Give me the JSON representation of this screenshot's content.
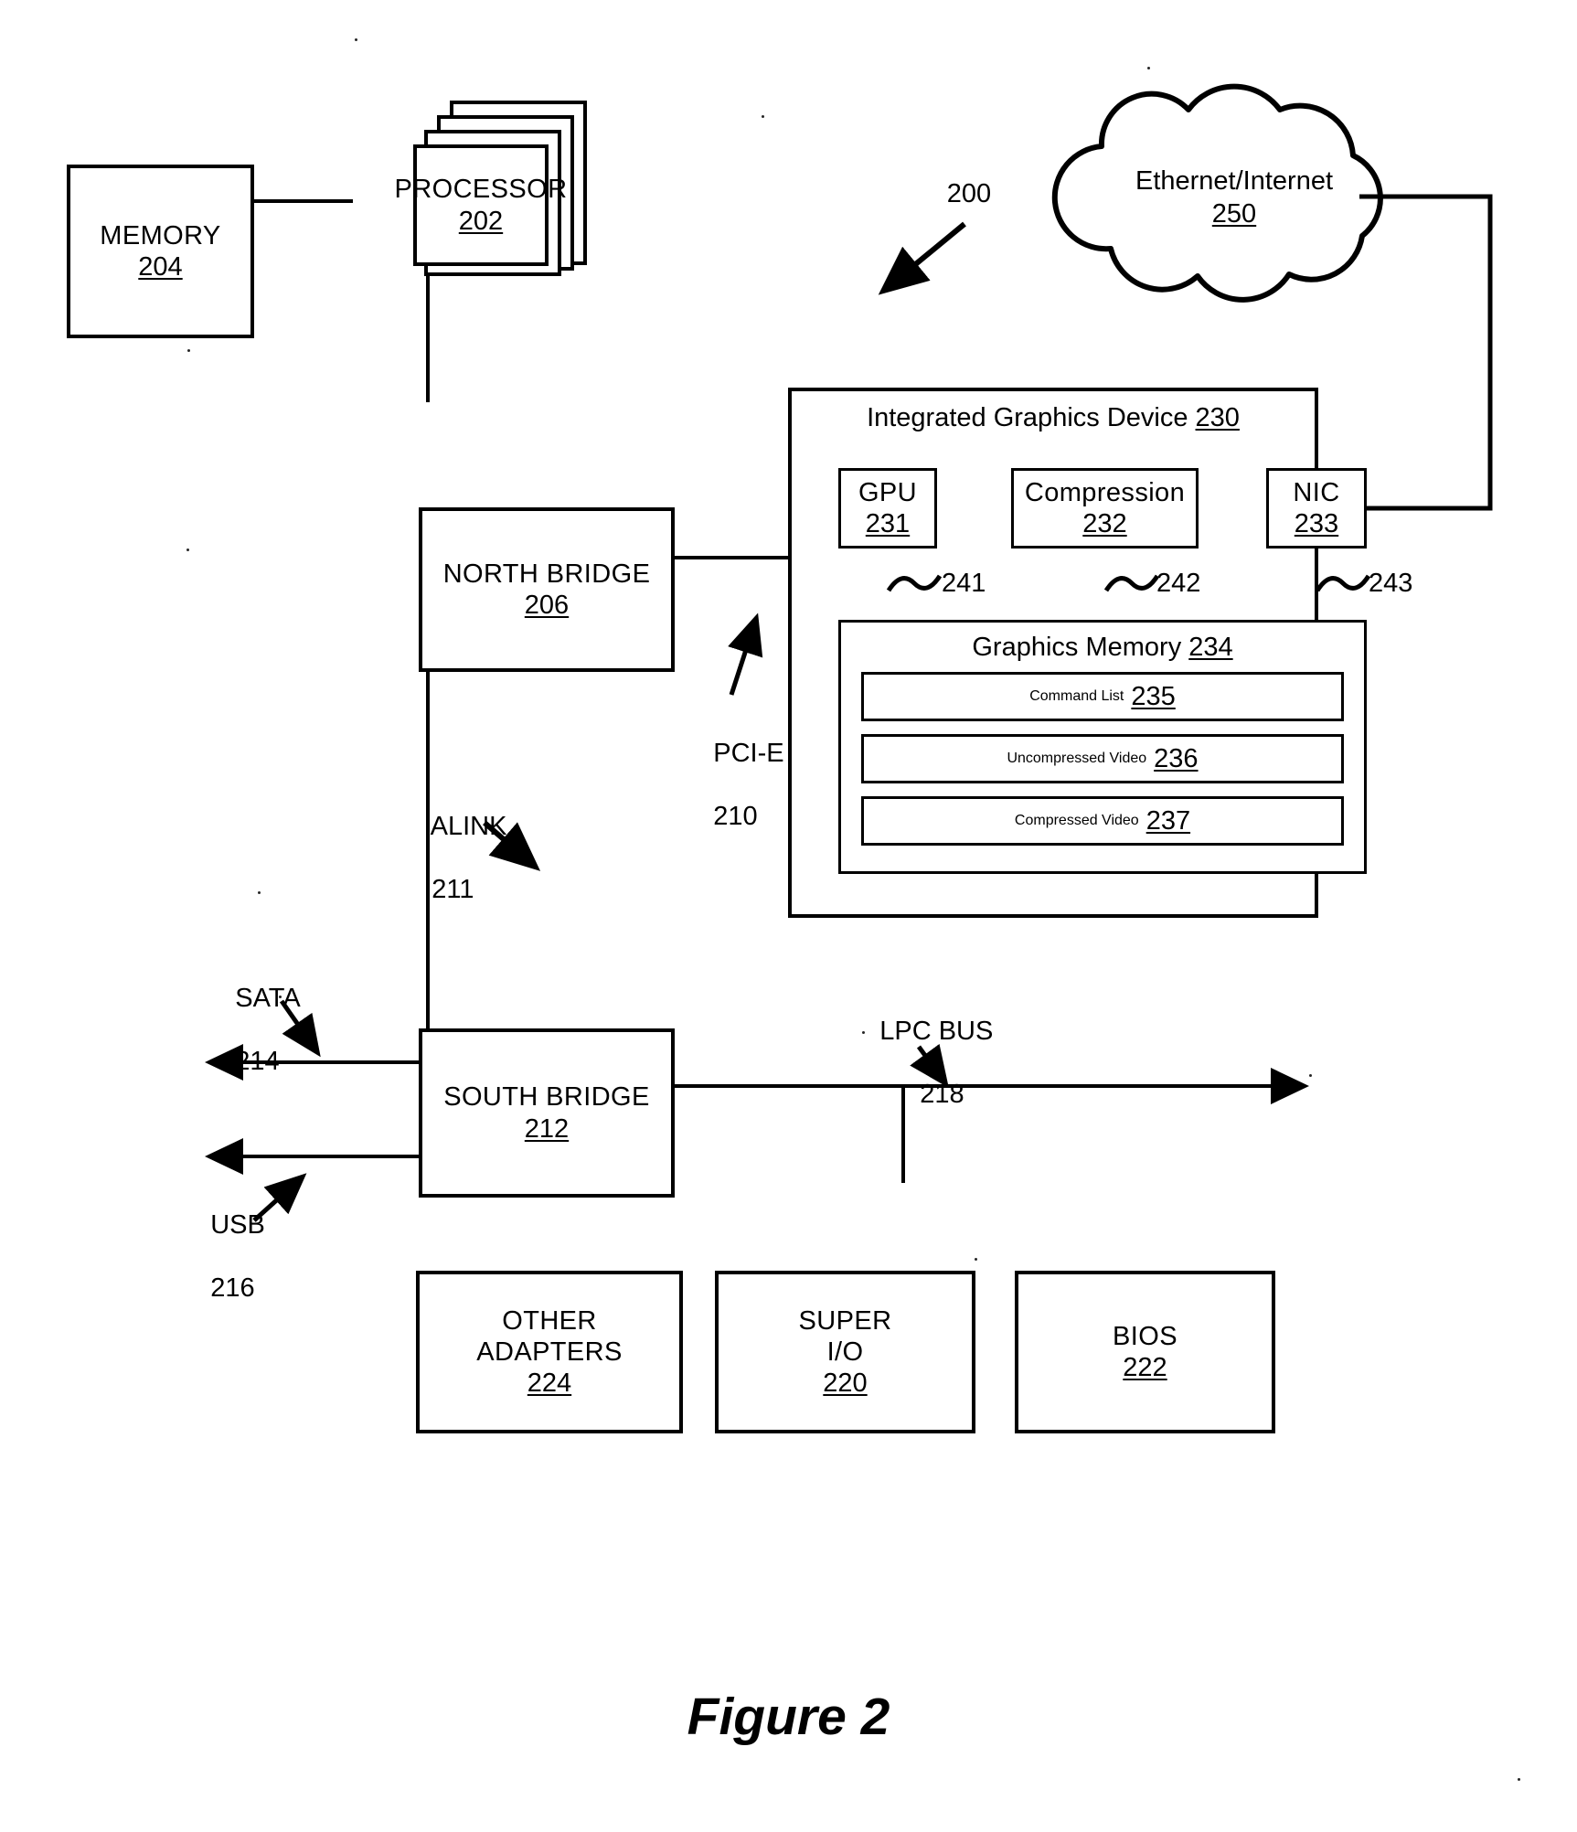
{
  "figure": {
    "caption": "Figure 2",
    "system_ref": "200"
  },
  "blocks": {
    "memory": {
      "title": "MEMORY",
      "ref": "204"
    },
    "processor": {
      "title": "PROCESSOR",
      "ref": "202"
    },
    "north_bridge": {
      "title": "NORTH BRIDGE",
      "ref": "206"
    },
    "south_bridge": {
      "title": "SOUTH BRIDGE",
      "ref": "212"
    },
    "other_adapters": {
      "title": "OTHER",
      "title2": "ADAPTERS",
      "ref": "224"
    },
    "super_io": {
      "title": "SUPER",
      "title2": "I/O",
      "ref": "220"
    },
    "bios": {
      "title": "BIOS",
      "ref": "222"
    }
  },
  "cloud": {
    "title": "Ethernet/Internet",
    "ref": "250"
  },
  "igd": {
    "title": "Integrated Graphics Device",
    "ref": "230",
    "gpu": {
      "title": "GPU",
      "ref": "231"
    },
    "compression": {
      "title": "Compression",
      "ref": "232"
    },
    "nic": {
      "title": "NIC",
      "ref": "233"
    },
    "graphics_memory": {
      "title": "Graphics Memory",
      "ref": "234",
      "rows": [
        {
          "title": "Command List",
          "ref": "235"
        },
        {
          "title": "Uncompressed Video",
          "ref": "236"
        },
        {
          "title": "Compressed Video",
          "ref": "237"
        }
      ]
    },
    "links": [
      {
        "ref": "241"
      },
      {
        "ref": "242"
      },
      {
        "ref": "243"
      }
    ]
  },
  "bus_labels": {
    "pcie": {
      "name": "PCI-E",
      "ref": "210"
    },
    "alink": {
      "name": "ALINK",
      "ref": "211"
    },
    "sata": {
      "name": "SATA",
      "ref": "214"
    },
    "usb": {
      "name": "USB",
      "ref": "216"
    },
    "lpc": {
      "name": "LPC BUS",
      "ref": "218"
    }
  },
  "colors": {
    "ink": "#000000",
    "paper": "#ffffff"
  }
}
